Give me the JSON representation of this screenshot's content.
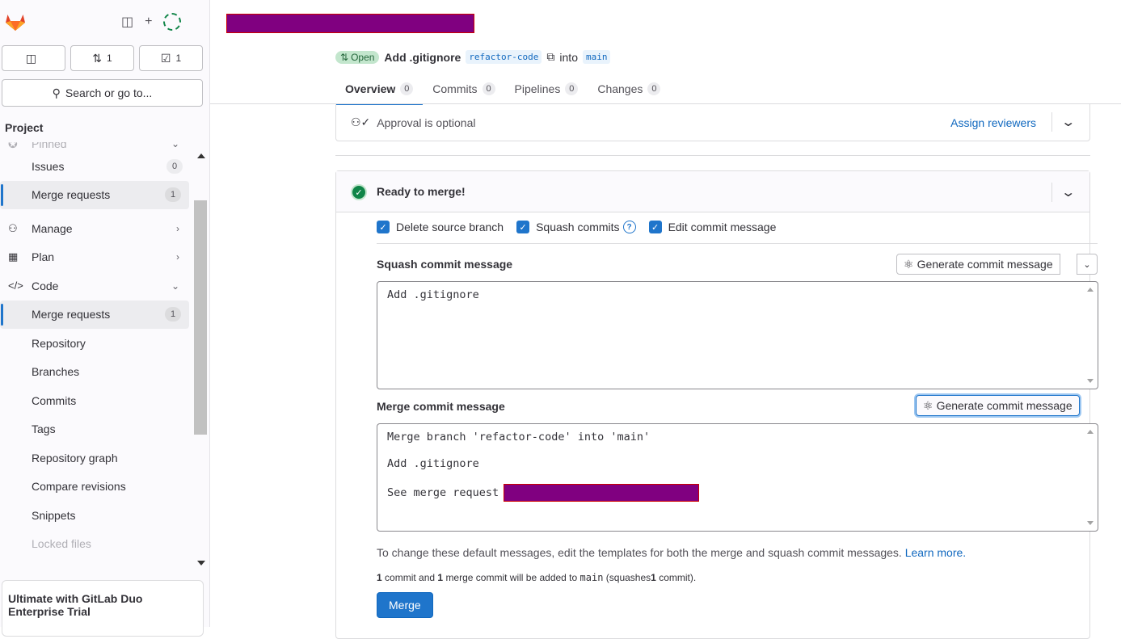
{
  "sidebar": {
    "counts": [
      {
        "icon": "issues-icon",
        "value": ""
      },
      {
        "icon": "merge-request-icon",
        "value": "1"
      },
      {
        "icon": "todo-icon",
        "value": "1"
      }
    ],
    "search_label": "Search or go to...",
    "project_label": "Project",
    "pinned_label": "Pinned",
    "items": [
      {
        "label": "Issues",
        "badge": "0"
      },
      {
        "label": "Merge requests",
        "badge": "1"
      },
      {
        "label": "Manage"
      },
      {
        "label": "Plan"
      },
      {
        "label": "Code"
      },
      {
        "label": "Merge requests",
        "badge": "1"
      },
      {
        "label": "Repository"
      },
      {
        "label": "Branches"
      },
      {
        "label": "Commits"
      },
      {
        "label": "Tags"
      },
      {
        "label": "Repository graph"
      },
      {
        "label": "Compare revisions"
      },
      {
        "label": "Snippets"
      },
      {
        "label": "Locked files"
      }
    ],
    "trial_label": "Ultimate with GitLab Duo Enterprise Trial"
  },
  "mr": {
    "status": "Open",
    "title": "Add .gitignore",
    "source_branch": "refactor-code",
    "into_label": "into",
    "target_branch": "main",
    "tabs": [
      {
        "label": "Overview",
        "count": "0"
      },
      {
        "label": "Commits",
        "count": "0"
      },
      {
        "label": "Pipelines",
        "count": "0"
      },
      {
        "label": "Changes",
        "count": "0"
      }
    ]
  },
  "approval": {
    "text": "Approval is optional",
    "assign_label": "Assign reviewers"
  },
  "merge": {
    "ready_label": "Ready to merge!",
    "options": {
      "delete_source": "Delete source branch",
      "squash": "Squash commits",
      "edit_message": "Edit commit message"
    },
    "squash_label": "Squash commit message",
    "generate_label": "Generate commit message",
    "squash_message": "Add .gitignore",
    "merge_label": "Merge commit message",
    "merge_message_line1": "Merge branch 'refactor-code' into 'main'",
    "merge_message_line2": "Add .gitignore",
    "merge_message_line3": "See merge request",
    "hint_text": "To change these default messages, edit the templates for both the merge and squash commit messages.",
    "learn_more": "Learn more.",
    "summary": {
      "n1": "1",
      "t1": "commit and",
      "n2": "1",
      "t2": "merge commit will be added to",
      "branch": "main",
      "t3": "(squashes",
      "n3": "1",
      "t4": "commit)."
    },
    "merge_button": "Merge"
  },
  "colors": {
    "accent": "#1f75cb",
    "success": "#108548",
    "redaction": "#800080"
  }
}
